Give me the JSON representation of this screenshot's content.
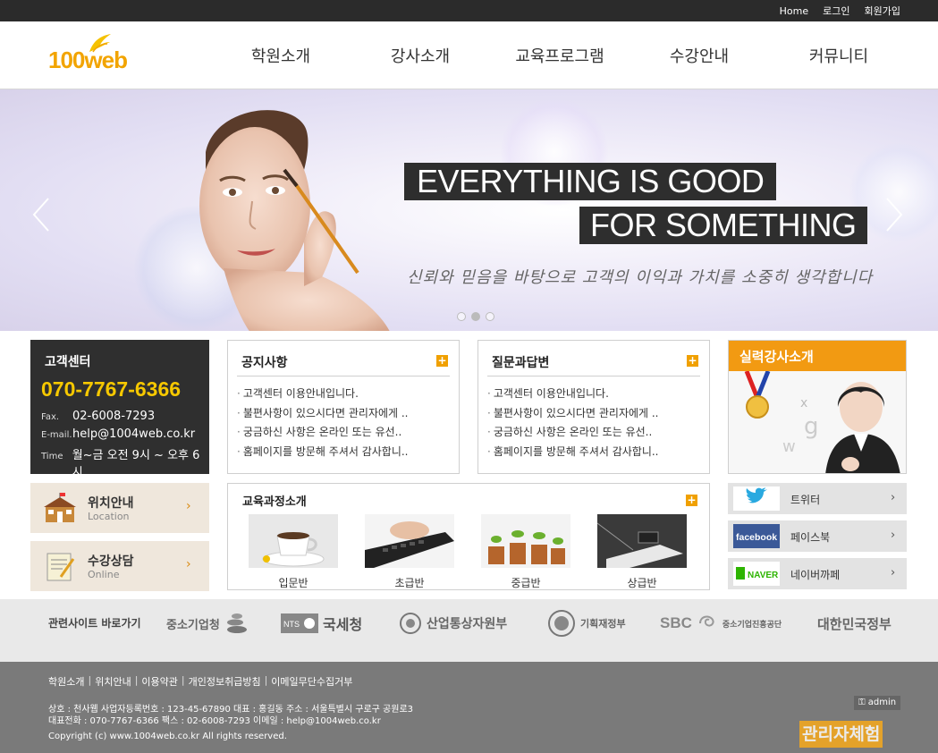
{
  "topbar": {
    "home": "Home",
    "login": "로그인",
    "signup": "회원가입"
  },
  "logo": {
    "num": "100",
    "word": "web"
  },
  "nav": [
    "학원소개",
    "강사소개",
    "교육프로그램",
    "수강안내",
    "커뮤니티"
  ],
  "hero": {
    "line1": "EVERYTHING IS GOOD",
    "line2": "FOR SOMETHING",
    "slogan": "신뢰와 믿음을 바탕으로 고객의 이익과 가치를 소중히 생각합니다"
  },
  "contact": {
    "title": "고객센터",
    "phone": "070-7767-6366",
    "fax_label": "Fax.",
    "fax": "02-6008-7293",
    "email_label": "E-mail.",
    "email": "help@1004web.co.kr",
    "time_label": "Time",
    "time": "월~금 오전 9시 ~ 오후 6시"
  },
  "quick": [
    {
      "title": "위치안내",
      "sub": "Location"
    },
    {
      "title": "수강상담",
      "sub": "Online"
    }
  ],
  "notice": {
    "title": "공지사항",
    "items": [
      "고객센터 이용안내입니다.",
      "불편사항이 있으시다면 관리자에게 ..",
      "궁금하신 사항은 온라인 또는 유선..",
      "홈페이지를 방문해 주셔서 감사합니.."
    ]
  },
  "qna": {
    "title": "질문과답변",
    "items": [
      "고객센터 이용안내입니다.",
      "불편사항이 있으시다면 관리자에게 ..",
      "궁금하신 사항은 온라인 또는 유선..",
      "홈페이지를 방문해 주셔서 감사합니.."
    ]
  },
  "teacher": {
    "title": "실력강사소개"
  },
  "edu": {
    "title": "교육과정소개",
    "items": [
      "입문반",
      "초급반",
      "중급반",
      "상급반"
    ]
  },
  "social": [
    {
      "brand": "twitter",
      "label": "트위터"
    },
    {
      "brand": "facebook",
      "label": "페이스북"
    },
    {
      "brand": "NAVER",
      "label": "네이버까페"
    }
  ],
  "partners": {
    "lead": "관련사이트 바로가기",
    "items": [
      "중소기업청",
      "국세청",
      "산업통상자원부",
      "기획재정부",
      "중소기업진흥공단",
      "대한민국정부"
    ],
    "nts": "NTS",
    "sbc": "SBC"
  },
  "footer": {
    "links": [
      "학원소개",
      "위치안내",
      "이용약관",
      "개인정보취급방침",
      "이메일무단수집거부"
    ],
    "info1": "상호 : 천사웹  사업자등록번호 : 123-45-67890  대표 : 홍길동  주소 : 서울특별시 구로구 공원로3",
    "info2": "대표전화 : 070-7767-6366  팩스 : 02-6008-7293  이메일 : help@1004web.co.kr",
    "copyright": "Copyright (c) www.1004web.co.kr All rights reserved.",
    "admin": "admin",
    "try": "관리자체험"
  },
  "colors": {
    "accent": "#f29a12",
    "dark": "#2f2f2f",
    "phone": "#f6c800"
  }
}
